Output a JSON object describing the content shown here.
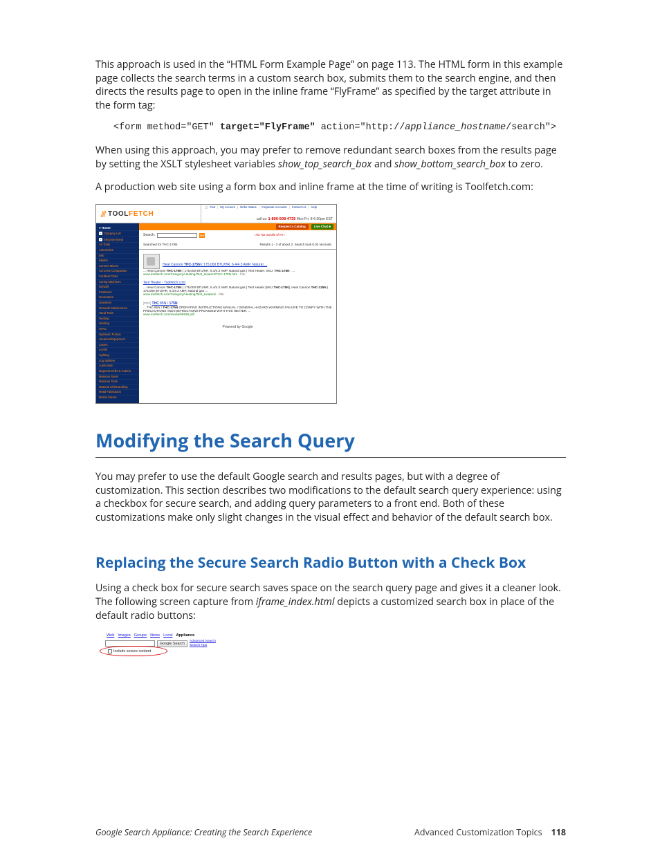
{
  "intro1": "This approach is used in the “HTML Form Example Page” on page 113. The HTML form in this example page collects the search terms in a custom search box, submits them to the search engine, and then directs the results page to open in the inline frame “FlyFrame” as specified by the target attribute in the form tag:",
  "code": {
    "p1": "<form method=\"GET\" ",
    "p2": "target=\"FlyFrame\"",
    "p3": " action=\"http://",
    "p4": "appliance_hostname",
    "p5": "/search\">"
  },
  "para2a": "When using this approach, you may prefer to remove redundant search boxes from the results page by setting the XSLT stylesheet variables ",
  "para2b": "show_top_search_box",
  "para2c": " and ",
  "para2d": "show_bottom_search_box",
  "para2e": " to zero.",
  "para3": "A production web site using a form box and inline frame at the time of writing is Toolfetch.com:",
  "toolfetch": {
    "logo_a": "TOOL",
    "logo_b": "FETCH",
    "toplinks": [
      "Cart",
      "My Account",
      "Order Status",
      "Corporate Accounts",
      "Contact Us",
      "Help"
    ],
    "phone_prefix": "call us: ",
    "phone": "1-800-508-4735",
    "phone_suffix": " Mon-Fri, 8-6:30pm EST",
    "btn_catalog": "Request a Catalog",
    "btn_chat": "Live Chat ■",
    "search_label": "Search:",
    "go": "GO",
    "notax": "‹ NO Tax outside of NY ›",
    "searched": "Searched for THC-175N",
    "results_meta": "Results 1 - 3 of about 3. Search took 0.02 seconds.",
    "nav_home": "● Home",
    "nav": [
      {
        "l": "Category List",
        "exp": true
      },
      {
        "l": "Shop By Brand",
        "exp": true
      },
      {
        "l": "Air Tools",
        "exp": false
      },
      {
        "l": "Automotive",
        "exp": false
      },
      {
        "l": "Bits",
        "exp": false
      },
      {
        "l": "Blades",
        "exp": false
      },
      {
        "l": "Cement Mixers",
        "exp": false
      },
      {
        "l": "Concrete Compaction",
        "exp": false
      },
      {
        "l": "Cordless Tools",
        "exp": false
      },
      {
        "l": "Coring Machines",
        "exp": false
      },
      {
        "l": "Drywall",
        "exp": false
      },
      {
        "l": "Fasteners",
        "exp": false
      },
      {
        "l": "Generators",
        "exp": false
      },
      {
        "l": "Gravelers",
        "exp": false
      },
      {
        "l": "Grounds Maintenance",
        "exp": false
      },
      {
        "l": "Hand Tools",
        "exp": false
      },
      {
        "l": "Heating",
        "exp": false
      },
      {
        "l": "Hoisting",
        "exp": false
      },
      {
        "l": "HVAC",
        "exp": false
      },
      {
        "l": "Hydraulic Pumps",
        "exp": false
      },
      {
        "l": "Janitorial Equipment",
        "exp": false
      },
      {
        "l": "Lasers",
        "exp": false
      },
      {
        "l": "Levels",
        "exp": false
      },
      {
        "l": "Lighting",
        "exp": false
      },
      {
        "l": "Log Splitters",
        "exp": false
      },
      {
        "l": "Lubrication",
        "exp": false
      },
      {
        "l": "Magnetic Drills & Cutters",
        "exp": false
      },
      {
        "l": "Masonry Saws",
        "exp": false
      },
      {
        "l": "Masonry Tools",
        "exp": false
      },
      {
        "l": "Material Lifts/Handling",
        "exp": false
      },
      {
        "l": "Metal Fabrication",
        "exp": false
      },
      {
        "l": "Mortar Mixers",
        "exp": false
      }
    ],
    "r1": {
      "title_a": "Heat Cannon ",
      "title_b": "THC-175N",
      "title_c": " ( 175,000 BTU/HR, 6.4/4.3 AMP, Natural ...",
      "snip_a": "... Heat Cannon ",
      "snip_b": "THC-175N",
      "snip_c": " ( 175,000 BTU/HR, 6.4/4.3 AMP, Natural gas ) Tent Heater. SKU: ",
      "snip_d": "THC-175N",
      "snip_e": " . ...",
      "url": "www.toolfetch.com/Category/Heating/Tent_Heaters/THC-175N.htm",
      "size": " - 51k"
    },
    "r2": {
      "title": "Tent Heater - Toolfetch.com",
      "snip_a": "... Heat Cannon ",
      "snip_b": "THC-175N",
      "snip_c": " ( 175,000 BTU/HR, 6.4/4.3 AMP, Natural gas ) Tent Heater [SKU ",
      "snip_d": "THC-175N",
      "snip_e": "]. Heat Cannon ",
      "snip_f": "THC-125N",
      "snip_g": " ( 175,000 BTU/HR, 6.4/4.3 AMP, Natural gas ...",
      "url": "www.toolfetch.com/Category/Heating/Tent_Heaters/",
      "size": " - 35k"
    },
    "r3": {
      "pdf": "[PDF]",
      "title_a": "THC",
      "title_b": " 85N / ",
      "title_c": "175N",
      "snip_a": "... THC-85N / ",
      "snip_b": "THC-175N",
      "snip_c": " OPERATING INSTRUCTIONS MANUAL ! GENERAL HAZARD WARNING FAILURE TO COMPY WITH THE PRECAUTIONS AND INSTRUCTIONS PROVIDED WITH THIS HEATER, ...",
      "url": "www.toolfetch.com/media/58535.pdf"
    },
    "powered": "Powered by Google"
  },
  "h1": "Modifying the Search Query",
  "para4": "You may prefer to use the default Google search and results pages, but with a degree of customization. This section describes two modifications to the default search query experience: using a checkbox for secure search, and adding query parameters to a front end. Both of these customizations make only slight changes in the visual effect and behavior of the default search box.",
  "h2": "Replacing the Secure Search Radio Button with a Check Box",
  "para5a": "Using a check box for secure search saves space on the search query page and gives it a cleaner look. The following screen capture from ",
  "para5b": "iframe_index.html",
  "para5c": " depicts a customized search box in place of the default radio buttons:",
  "google": {
    "tabs": [
      "Web",
      "Images",
      "Groups",
      "News",
      "Local",
      "Appliance"
    ],
    "active": 5,
    "btn": "Google Search",
    "adv": "Advanced Search",
    "tips": "Search Tips",
    "check": "Include secure content"
  },
  "footer": {
    "left": "Google Search Appliance: Creating the Search Experience",
    "right_a": "Advanced Customization Topics",
    "right_b": "118"
  }
}
